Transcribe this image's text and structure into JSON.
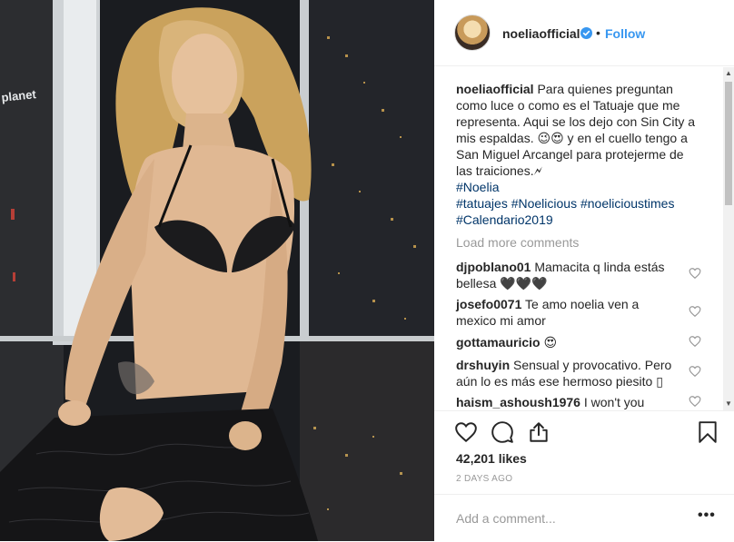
{
  "post": {
    "image_alt": "Photo"
  },
  "header": {
    "username": "noeliaofficial",
    "separator": "•",
    "follow_label": "Follow"
  },
  "caption": {
    "username": "noeliaofficial",
    "text": "Para quienes preguntan como luce o como es el Tatuaje que me representa. Aqui se los dejo con Sin City a mis espaldas. 😉😍 y en el cuello tengo a San Miguel Arcangel para protejerme de las traiciones.🗲",
    "hashtags": [
      "#Noelia",
      "#tatuajes #Noelicious #noelicioustimes",
      "#Calendario2019"
    ]
  },
  "load_more": "Load more comments",
  "comments": [
    {
      "user": "djpoblano01",
      "text": "Mamacita q linda estás bellesa 🖤🖤🖤"
    },
    {
      "user": "josefo0071",
      "text": "Te amo noelia ven a mexico mi amor"
    },
    {
      "user": "gottamauricio",
      "text": "😍"
    },
    {
      "user": "drshuyin",
      "text": "Sensual y provocativo. Pero aún lo es más ese hermoso piesito ▯"
    },
    {
      "user": "haism_ashoush1976",
      "text": "I won't you"
    }
  ],
  "actions": {
    "likes": "42,201 likes",
    "time": "2 DAYS AGO"
  },
  "add_comment": {
    "placeholder": "Add a comment...",
    "more_label": "•••"
  },
  "colors": {
    "link": "#3897f0",
    "hashtag": "#003569",
    "muted": "#999999",
    "text": "#262626"
  },
  "icons": [
    "verified-badge-icon",
    "heart-outline-icon",
    "comment-icon",
    "share-icon",
    "bookmark-icon",
    "scroll-up-arrow",
    "scroll-down-arrow"
  ]
}
